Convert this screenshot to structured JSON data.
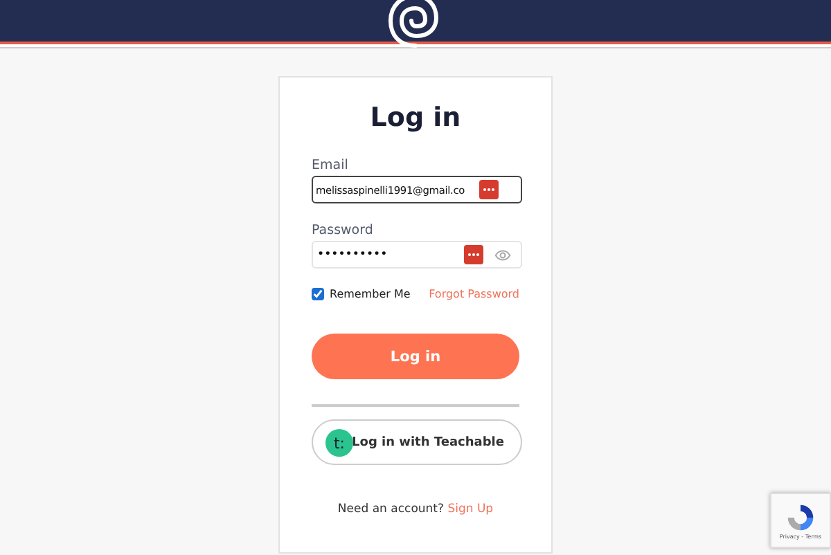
{
  "title": "Log in",
  "email": {
    "label": "Email",
    "value": "melissaspinelli1991@gmail.co"
  },
  "password": {
    "label": "Password",
    "value": "••••••••••"
  },
  "remember": {
    "label": "Remember Me",
    "checked": true
  },
  "forgot_link": "Forgot Password",
  "login_button": "Log in",
  "teachable_button": {
    "logo": "t:",
    "label": "Log in with Teachable"
  },
  "signup": {
    "text": "Need an account?",
    "link": "Sign Up"
  },
  "recaptcha": {
    "text": "Privacy - Terms"
  }
}
